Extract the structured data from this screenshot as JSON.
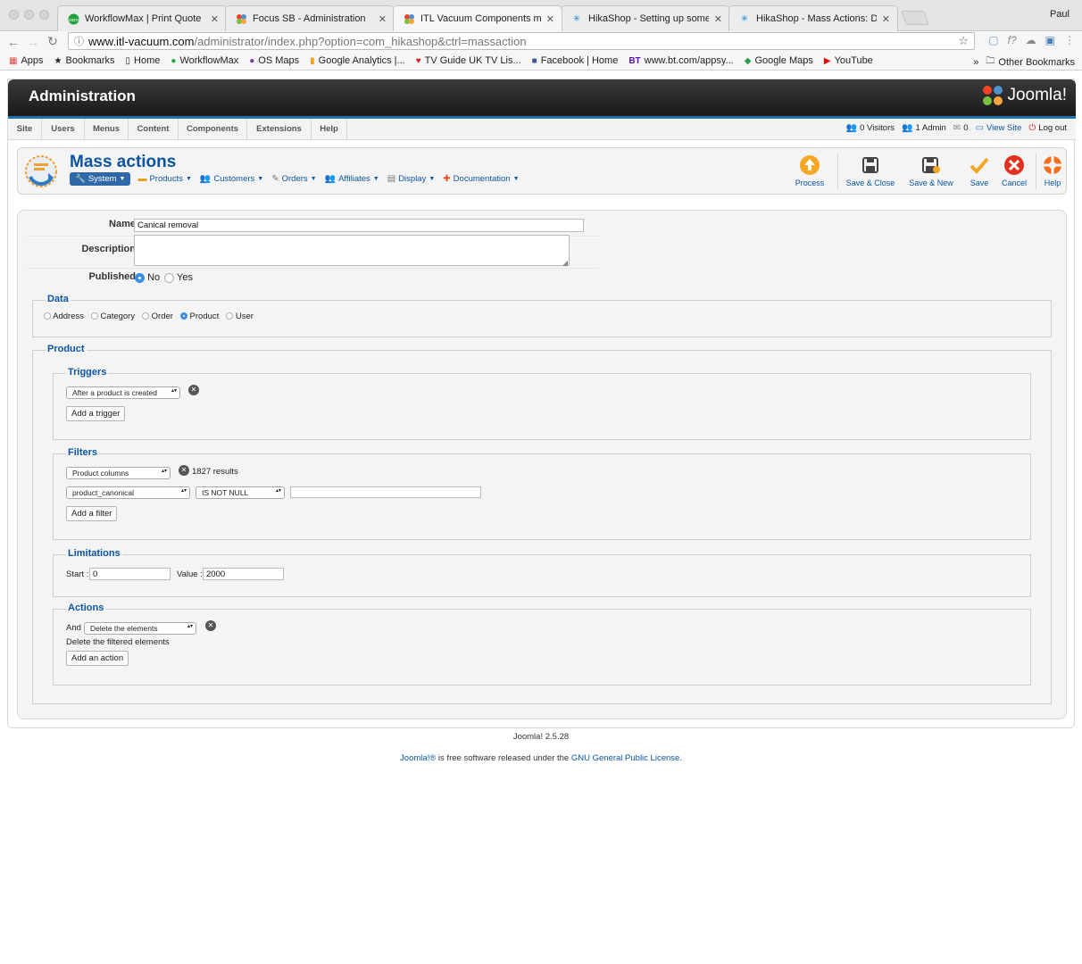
{
  "browser": {
    "profile": "Paul",
    "tabs": [
      {
        "title": "WorkflowMax | Print Quote",
        "icon": "workflowmax-icon"
      },
      {
        "title": "Focus SB - Administration",
        "icon": "joomla-icon"
      },
      {
        "title": "ITL Vacuum Components man",
        "icon": "joomla-icon"
      },
      {
        "title": "HikaShop - Setting up some c",
        "icon": "hikashop-icon"
      },
      {
        "title": "HikaShop - Mass Actions: Doc",
        "icon": "hikashop-icon"
      }
    ],
    "url_host": "www.itl-vacuum.com",
    "url_path": "/administrator/index.php?option=com_hikashop&ctrl=massaction",
    "bookmarks": [
      "Apps",
      "Bookmarks",
      "Home",
      "WorkflowMax",
      "OS Maps",
      "Google Analytics |...",
      "TV Guide UK TV Lis...",
      "Facebook | Home",
      "www.bt.com/appsy...",
      "Google Maps",
      "YouTube"
    ],
    "bookmarks_more": "»",
    "other_bookmarks": "Other Bookmarks"
  },
  "admin": {
    "header_title": "Administration",
    "logo_text": "Joomla!",
    "menu": [
      "Site",
      "Users",
      "Menus",
      "Content",
      "Components",
      "Extensions",
      "Help"
    ],
    "status": {
      "visitors": "0 Visitors",
      "admins": "1 Admin",
      "messages": "0",
      "view_site": "View Site",
      "logout": "Log out"
    }
  },
  "toolbar": {
    "page_title": "Mass actions",
    "submenu": [
      "System",
      "Products",
      "Customers",
      "Orders",
      "Affiliates",
      "Display",
      "Documentation"
    ],
    "buttons": [
      "Process",
      "Save & Close",
      "Save & New",
      "Save",
      "Cancel",
      "Help"
    ]
  },
  "form": {
    "name_label": "Name",
    "name_value": "Canical removal",
    "description_label": "Description",
    "published_label": "Published",
    "published_no": "No",
    "published_yes": "Yes",
    "published_value": "No",
    "data_legend": "Data",
    "data_options": [
      "Address",
      "Category",
      "Order",
      "Product",
      "User"
    ],
    "data_selected": "Product",
    "product_legend": "Product",
    "triggers": {
      "legend": "Triggers",
      "select_value": "After a product is created",
      "add_button": "Add a trigger"
    },
    "filters": {
      "legend": "Filters",
      "select_value": "Product columns",
      "results": "1827 results",
      "column_value": "product_canonical",
      "operator_value": "IS NOT NULL",
      "value_input": "",
      "add_button": "Add a filter"
    },
    "limitations": {
      "legend": "Limitations",
      "start_label": "Start :",
      "start_value": "0",
      "value_label": "Value :",
      "value_value": "2000"
    },
    "actions": {
      "legend": "Actions",
      "and_label": "And",
      "select_value": "Delete the elements",
      "description": "Delete the filtered elements",
      "add_button": "Add an action"
    }
  },
  "footer": {
    "version": "Joomla! 2.5.28",
    "license_link1": "Joomla!®",
    "license_text": " is free software released under the ",
    "license_link2": "GNU General Public License",
    "license_end": "."
  },
  "colors": {
    "accent": "#0b55a0",
    "header_dark": "#1c1c1c",
    "stripe_blue": "#1e73a8",
    "radio_on": "#3b8eea"
  }
}
